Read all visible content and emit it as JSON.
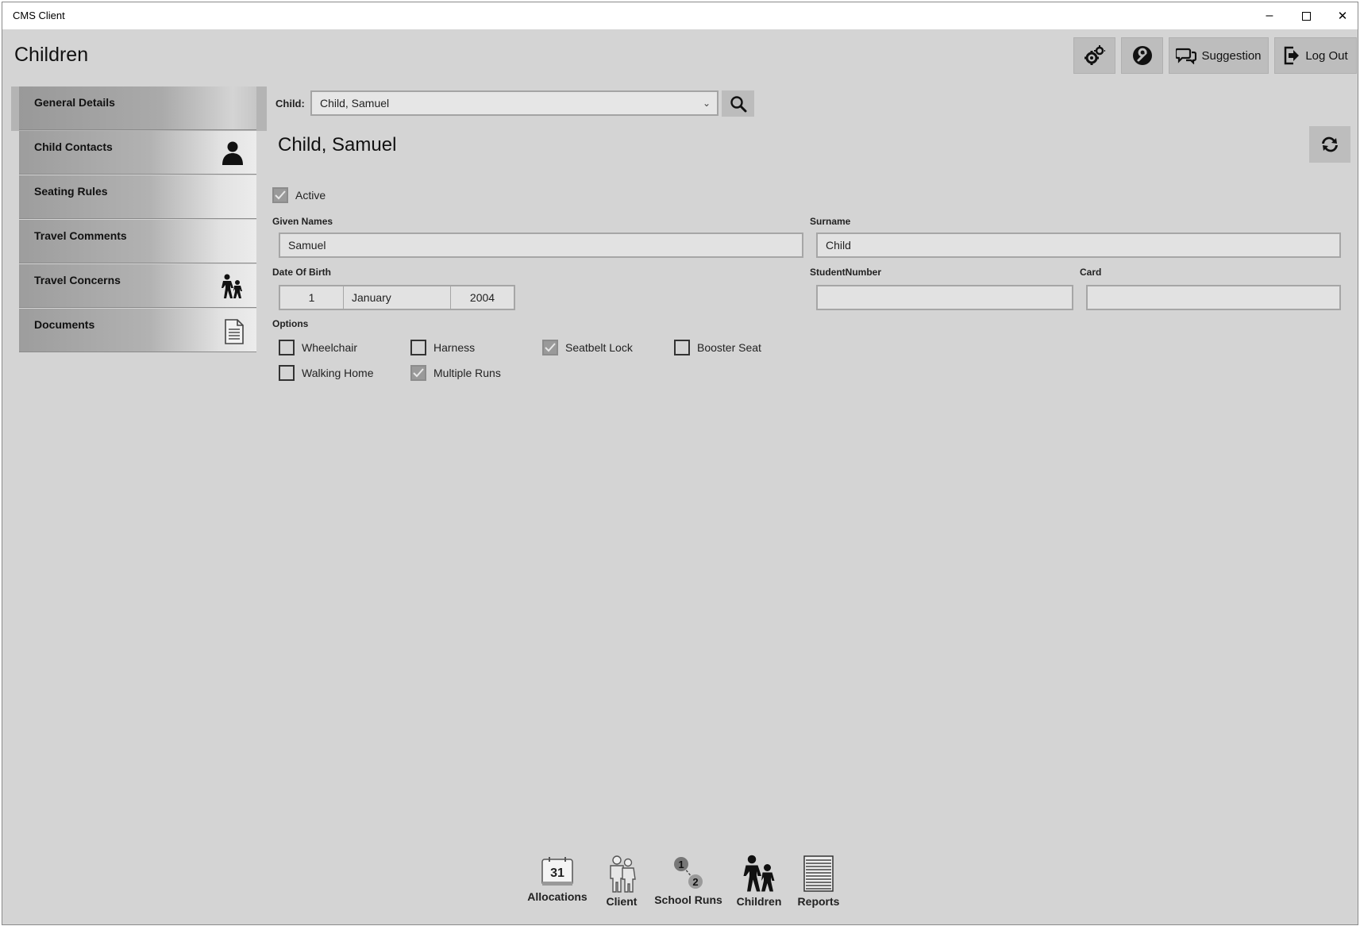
{
  "window": {
    "title": "CMS Client",
    "controls": {
      "minimize": "–",
      "maximize": "☐",
      "close": "✕"
    }
  },
  "header": {
    "title": "Children",
    "buttons": {
      "settings_icon": "gears-icon",
      "wrench_icon": "wrench-icon",
      "suggestion_label": "Suggestion",
      "logout_label": "Log Out"
    }
  },
  "sidebar": {
    "items": [
      {
        "label": "General Details",
        "icon": "",
        "selected": true
      },
      {
        "label": "Child Contacts",
        "icon": "person-icon"
      },
      {
        "label": "Seating Rules",
        "icon": ""
      },
      {
        "label": "Travel Comments",
        "icon": ""
      },
      {
        "label": "Travel Concerns",
        "icon": "children-walking-icon"
      },
      {
        "label": "Documents",
        "icon": "document-icon"
      }
    ]
  },
  "selector": {
    "label": "Child:",
    "value": "Child, Samuel"
  },
  "details": {
    "heading": "Child, Samuel",
    "active_label": "Active",
    "active_checked": true,
    "given_names_label": "Given Names",
    "given_names_value": "Samuel",
    "surname_label": "Surname",
    "surname_value": "Child",
    "dob_label": "Date Of Birth",
    "dob_day": "1",
    "dob_month": "January",
    "dob_year": "2004",
    "student_number_label": "StudentNumber",
    "student_number_value": "",
    "card_label": "Card",
    "card_value": "",
    "options_label": "Options",
    "options": [
      {
        "label": "Wheelchair",
        "checked": false
      },
      {
        "label": "Harness",
        "checked": false
      },
      {
        "label": "Seatbelt Lock",
        "checked": true
      },
      {
        "label": "Booster Seat",
        "checked": false
      },
      {
        "label": "Walking Home",
        "checked": false
      },
      {
        "label": "Multiple Runs",
        "checked": true
      }
    ]
  },
  "bottom_nav": {
    "items": [
      {
        "label": "Allocations",
        "icon": "calendar-icon",
        "calendar_day": "31"
      },
      {
        "label": "Client",
        "icon": "people-icon"
      },
      {
        "label": "School Runs",
        "icon": "route-icon",
        "stop_1": "1",
        "stop_2": "2"
      },
      {
        "label": "Children",
        "icon": "children-walking-icon"
      },
      {
        "label": "Reports",
        "icon": "report-icon"
      }
    ]
  },
  "colors": {
    "background": "#d4d4d4",
    "button": "#bdbdbd",
    "field": "#e2e2e2"
  }
}
